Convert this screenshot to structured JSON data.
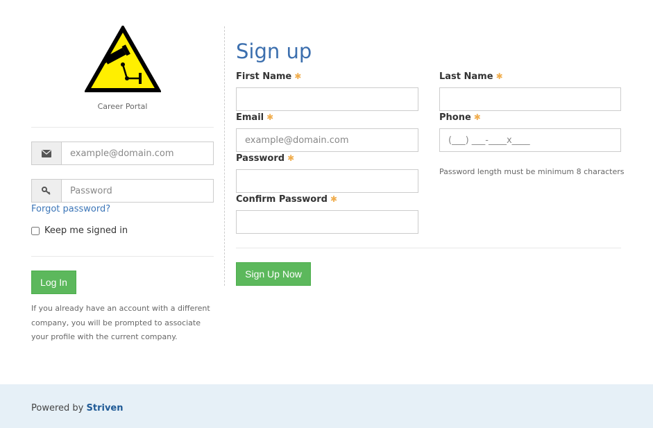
{
  "brand": {
    "logo": "cctv-warning-sign-icon",
    "portal_name": "Career Portal"
  },
  "login": {
    "email_placeholder": "example@domain.com",
    "email_icon": "envelope-icon",
    "password_placeholder": "Password",
    "password_icon": "key-icon",
    "forgot_password": "Forgot password?",
    "keep_signed_in": "Keep me signed in",
    "keep_signed_in_checked": false,
    "login_button": "Log In",
    "note": "If you already have an account with a different company, you will be prompted to associate your profile with the current company."
  },
  "signup": {
    "title": "Sign up",
    "required_marker": "✱",
    "fields": {
      "first_name": {
        "label": "First Name",
        "value": "",
        "placeholder": ""
      },
      "last_name": {
        "label": "Last Name",
        "value": "",
        "placeholder": ""
      },
      "email": {
        "label": "Email",
        "value": "",
        "placeholder": "example@domain.com"
      },
      "phone": {
        "label": "Phone",
        "value": "",
        "placeholder": "(___) ___-____x____"
      },
      "password": {
        "label": "Password",
        "value": "",
        "placeholder": ""
      },
      "confirm_password": {
        "label": "Confirm Password",
        "value": "",
        "placeholder": ""
      }
    },
    "password_hint": "Password length must be minimum 8 characters",
    "submit_button": "Sign Up Now"
  },
  "footer": {
    "powered_by": "Powered by",
    "brand": "Striven"
  },
  "colors": {
    "accent_blue": "#3c6fae",
    "link_blue": "#3c76b8",
    "button_green": "#5cb85c",
    "required_orange": "#f0ad4e",
    "footer_bg": "#e6f0f7"
  }
}
